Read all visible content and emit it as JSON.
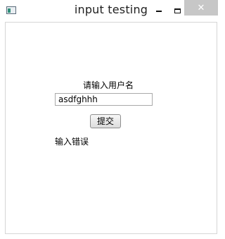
{
  "window": {
    "title": "input testing",
    "icons": {
      "app": "app-icon",
      "minimize": "minimize-icon",
      "maximize": "maximize-icon",
      "close": "close-icon"
    },
    "close_glyph": "✕"
  },
  "form": {
    "prompt_label": "请输入用户名",
    "username_value": "asdfghhh",
    "submit_label": "提交",
    "error_message": "输入错误"
  },
  "colors": {
    "close_button_bg": "#c7c7c7",
    "border": "#d6d6d6"
  }
}
